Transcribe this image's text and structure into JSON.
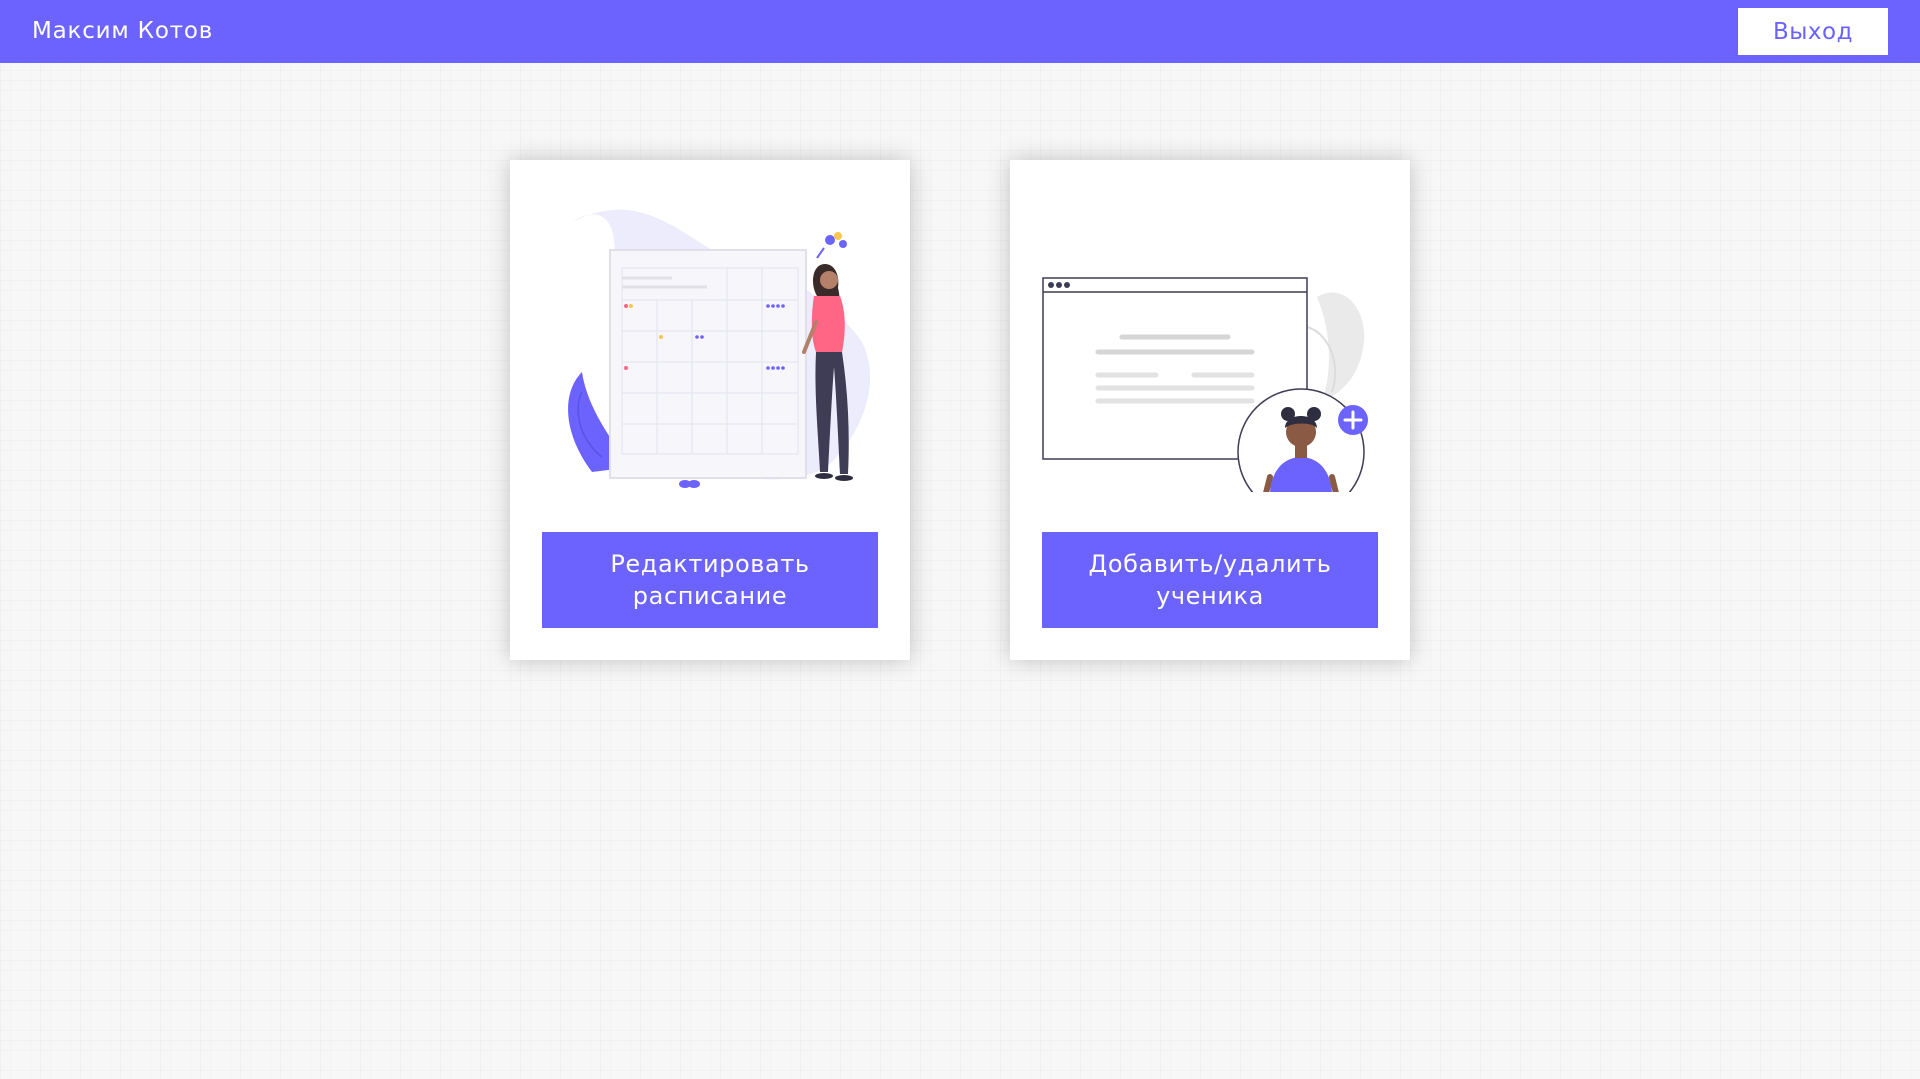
{
  "header": {
    "user_name": "Максим Котов",
    "logout_label": "Выход"
  },
  "cards": [
    {
      "illustration": "schedule-calendar-illustration",
      "button_label": "Редактировать расписание"
    },
    {
      "illustration": "add-user-illustration",
      "button_label": "Добавить/удалить ученика"
    }
  ],
  "colors": {
    "accent": "#6c63ff",
    "background": "#f7f7f7",
    "card": "#ffffff"
  }
}
